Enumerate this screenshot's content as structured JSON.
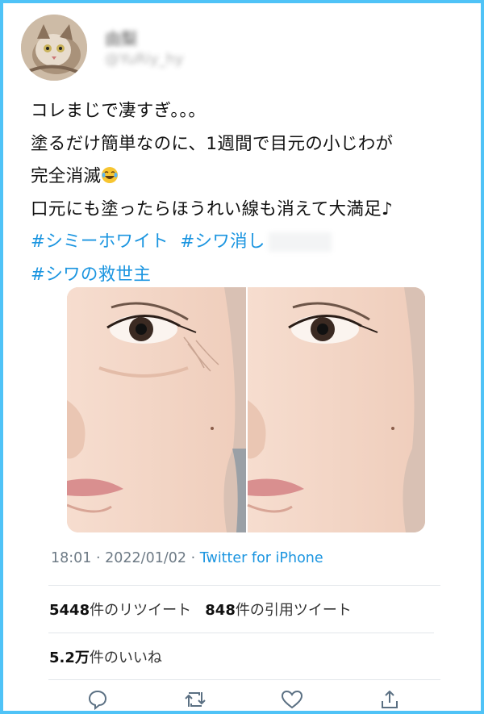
{
  "user": {
    "display_name": "由梨",
    "handle": "@YuRiy_hy",
    "avatar_icon": "cat-photo-icon"
  },
  "tweet": {
    "lines": [
      "コレまじで凄すぎ。。。",
      "塗るだけ簡単なのに、1週間で目元の小じわが",
      "完全消滅",
      "口元にも塗ったらほうれい線も消えて大満足♪"
    ],
    "emoji_icon": "tears-of-joy-emoji-icon",
    "hashtags": [
      "#シミーホワイト",
      "#シワ消し",
      "#シワの救世主"
    ]
  },
  "photo": {
    "description_icon": "before-after-face-photo-icon"
  },
  "meta": {
    "time": "18:01",
    "separator": " · ",
    "date": "2022/01/02",
    "source": "Twitter for iPhone"
  },
  "stats": {
    "retweets_count": "5448",
    "retweets_label": "件のリツイート",
    "quotes_count": "848",
    "quotes_label": "件の引用ツイート",
    "likes_count": "5.2万",
    "likes_label": "件のいいね"
  },
  "actions": [
    "reply-icon",
    "retweet-icon",
    "like-icon",
    "share-icon"
  ],
  "colors": {
    "accent": "#1b95e0",
    "frame": "#4fc3f7"
  }
}
